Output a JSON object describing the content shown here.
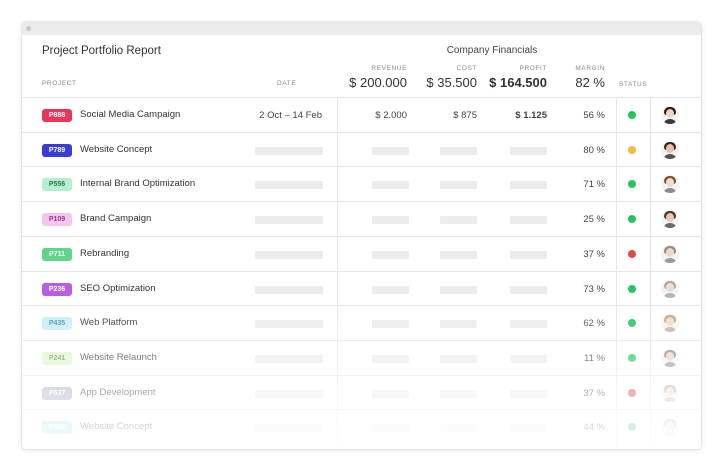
{
  "report": {
    "title": "Project Portfolio Report",
    "group_title": "Company Financials"
  },
  "columns": {
    "project": "PROJECT",
    "date": "DATE",
    "revenue": "REVENUE",
    "cost": "COST",
    "profit": "PROFIT",
    "margin": "MARGIN",
    "status": "STATUS"
  },
  "totals": {
    "revenue": "$ 200.000",
    "cost": "$ 35.500",
    "profit": "$ 164.500",
    "margin": "82 %"
  },
  "status_colors": {
    "green": "#22c55e",
    "yellow": "#f5b942",
    "red": "#e0484b"
  },
  "rows": [
    {
      "code": "P888",
      "name": "Social Media Campaign",
      "tag_color": "#e8375b",
      "tag_text_color": "#ffffff",
      "date": "2 Oct  –  14 Feb",
      "revenue": "$ 2.000",
      "cost": "$ 875",
      "profit": "$ 1.125",
      "margin": "56 %",
      "status": "green",
      "avatar": "avatar-dark-hair-woman"
    },
    {
      "code": "P789",
      "name": "Website Concept",
      "tag_color": "#3b3bd6",
      "tag_text_color": "#ffffff",
      "date": "",
      "revenue": "",
      "cost": "",
      "profit": "",
      "margin": "80 %",
      "status": "yellow",
      "avatar": "avatar-woman"
    },
    {
      "code": "P556",
      "name": "Internal Brand Optimization",
      "tag_color": "#b6efcf",
      "tag_text_color": "#2f7a52",
      "date": "",
      "revenue": "",
      "cost": "",
      "profit": "",
      "margin": "71 %",
      "status": "green",
      "avatar": "avatar-curly-hair"
    },
    {
      "code": "P109",
      "name": "Brand Campaign",
      "tag_color": "#f4c6ef",
      "tag_text_color": "#9a3b8d",
      "date": "",
      "revenue": "",
      "cost": "",
      "profit": "",
      "margin": "25 %",
      "status": "green",
      "avatar": "avatar-man"
    },
    {
      "code": "P711",
      "name": "Rebranding",
      "tag_color": "#5fd48a",
      "tag_text_color": "#ffffff",
      "date": "",
      "revenue": "",
      "cost": "",
      "profit": "",
      "margin": "37 %",
      "status": "red",
      "avatar": "avatar-man-glasses"
    },
    {
      "code": "P236",
      "name": "SEO Optimization",
      "tag_color": "#b85ee0",
      "tag_text_color": "#ffffff",
      "date": "",
      "revenue": "",
      "cost": "",
      "profit": "",
      "margin": "73 %",
      "status": "green",
      "avatar": "avatar-man-light"
    },
    {
      "code": "P435",
      "name": "Web Platform",
      "tag_color": "#c7ecfb",
      "tag_text_color": "#4a8fb0",
      "date": "",
      "revenue": "",
      "cost": "",
      "profit": "",
      "margin": "62 %",
      "status": "green",
      "avatar": "avatar-woman-blonde"
    },
    {
      "code": "P241",
      "name": "Website Relaunch",
      "tag_color": "#d9f7c9",
      "tag_text_color": "#6a9c52",
      "date": "",
      "revenue": "",
      "cost": "",
      "profit": "",
      "margin": "11 %",
      "status": "green",
      "avatar": "avatar-man-grey"
    },
    {
      "code": "P537",
      "name": "App Development",
      "tag_color": "#aab1c7",
      "tag_text_color": "#ffffff",
      "date": "",
      "revenue": "",
      "cost": "",
      "profit": "",
      "margin": "37 %",
      "status": "red",
      "avatar": "avatar-woman-light"
    },
    {
      "code": "P980",
      "name": "Website Concept",
      "tag_color": "#9fe3ee",
      "tag_text_color": "#ffffff",
      "date": "",
      "revenue": "",
      "cost": "",
      "profit": "",
      "margin": "44 %",
      "status": "green",
      "avatar": "avatar-person-light"
    }
  ]
}
